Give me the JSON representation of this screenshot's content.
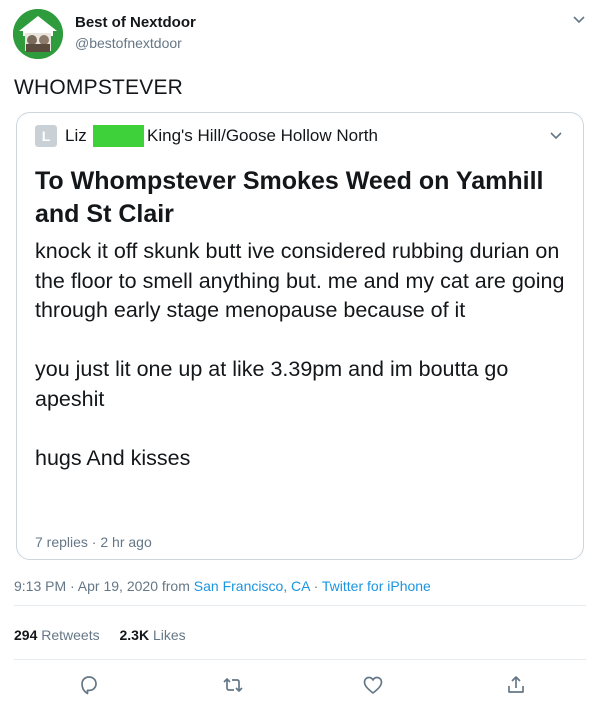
{
  "author": {
    "display_name": "Best of Nextdoor",
    "handle": "@bestofnextdoor"
  },
  "tweet": {
    "text": "WHOMPSTEVER"
  },
  "quoted_post": {
    "avatar_letter": "L",
    "author_first": "Liz",
    "location": "King's Hill/Goose Hollow North",
    "title": "To Whompstever Smokes Weed on Yamhill and St Clair",
    "paragraphs": [
      "knock it off skunk butt ive considered rubbing durian on the floor to smell anything but. me and my cat are going through early stage menopause because of it",
      "you just lit one up at like 3.39pm and im boutta go apeshit",
      "hugs And kisses"
    ],
    "meta": "7 replies · 2 hr ago"
  },
  "timestamp": {
    "time_date": "9:13 PM · Apr 19, 2020 from ",
    "location": "San Francisco, CA",
    "separator": " · ",
    "source": "Twitter for iPhone"
  },
  "stats": {
    "retweets_count": "294",
    "retweets_label": "Retweets",
    "likes_count": "2.3K",
    "likes_label": "Likes"
  },
  "icons": {
    "reply": "reply-icon",
    "retweet": "retweet-icon",
    "like": "like-icon",
    "share": "share-icon"
  },
  "colors": {
    "link": "#1b95e0",
    "muted": "#657786",
    "redaction": "#3fd13a"
  }
}
